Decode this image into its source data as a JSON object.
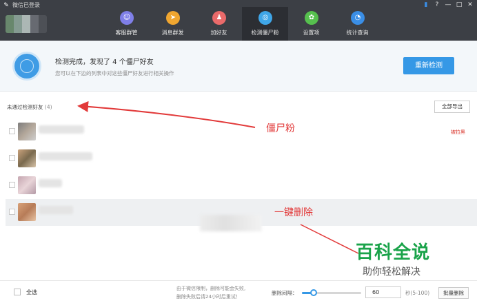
{
  "window": {
    "title": "微信已登录",
    "controls": [
      "▮",
      "?",
      "—",
      "□",
      "✕"
    ]
  },
  "nav": [
    {
      "label": "客服群管",
      "icon": "headset-icon",
      "color": "#7f7fe8"
    },
    {
      "label": "消息群发",
      "icon": "paper-plane-icon",
      "color": "#f0a630"
    },
    {
      "label": "加好友",
      "icon": "add-user-icon",
      "color": "#ea6a6a"
    },
    {
      "label": "检测僵尸粉",
      "icon": "detect-icon",
      "color": "#3fa6e8",
      "active": true
    },
    {
      "label": "设置项",
      "icon": "gear-icon",
      "color": "#56c04e"
    },
    {
      "label": "统计查询",
      "icon": "pie-chart-icon",
      "color": "#3a8ee6"
    }
  ],
  "status": {
    "title": "检测完成，发现了 4 个僵尸好友",
    "subtitle": "您可以在下边的列表中对这些僵尸好友进行相关操作",
    "recheck_label": "重新检测"
  },
  "list": {
    "header_label": "未通过检测好友",
    "header_count": "(4)",
    "export_label": "全部导出",
    "row_tag": "被拉黑"
  },
  "annotations": {
    "zombie": "僵尸粉",
    "delete": "一键删除"
  },
  "watermark": {
    "title": "百科全说",
    "subtitle": "助你轻松解决"
  },
  "footer": {
    "select_all": "全选",
    "note_line1": "由于微信限制，删除可能会失败,",
    "note_line2": "删除失败后请24小时后重试！",
    "interval_label": "删除间隔：",
    "interval_value": "60",
    "interval_unit": "秒(5-100)",
    "batch_delete": "批量删除",
    "slider_fraction": 0.2
  },
  "colors": {
    "header_bg": "#3c3f45",
    "accent": "#3598e6",
    "annotation": "#e23a3a",
    "watermark": "#1aa34a"
  }
}
